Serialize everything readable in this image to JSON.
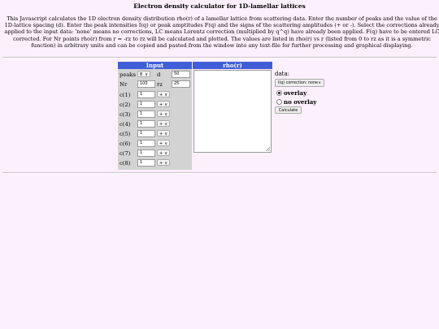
{
  "page": {
    "title": "Electron density calculator for 1D-lamellar lattices",
    "intro_lines": [
      "This Javascript calculates the 1D electron density distribution rho(r) of a lamellar lattice from scattering data. Enter the number of peaks and the value of the",
      "1D-lattice spacing (d). Enter the peak intensities I(q) or peak amptitudes F(q) and the signs of the scattering amplitudes (+ or -). Select the corrections already",
      "applied to the input data: 'none' means no corrections, LC means Lorentz correction (multiplied by q^q) have already been applied. F(q) have to be entered LC",
      "corrected. For Nr points rho(r) from r = -rz to rz will be calculated and plotted. The values are listed in rho(r) vs r (listed from 0 to rz as it is a symmetric",
      "function) in arbitrary units and can be copied and pasted from the window into any text-file for further processing and graphical displaying."
    ]
  },
  "input_panel": {
    "header": "Input",
    "peaks_label": "peaks",
    "peaks_value": "8",
    "d_label": "d",
    "d_value": "50",
    "nr_label": "Nr",
    "nr_value": "100",
    "rz_label": "rz",
    "rz_value": "25",
    "coefficients": [
      {
        "label": "c(1)",
        "value": "1",
        "sign": "+"
      },
      {
        "label": "c(2)",
        "value": "1",
        "sign": "+"
      },
      {
        "label": "c(3)",
        "value": "1",
        "sign": "+"
      },
      {
        "label": "c(4)",
        "value": "1",
        "sign": "+"
      },
      {
        "label": "c(5)",
        "value": "1",
        "sign": "+"
      },
      {
        "label": "c(6)",
        "value": "1",
        "sign": "+"
      },
      {
        "label": "c(7)",
        "value": "1",
        "sign": "+"
      },
      {
        "label": "c(8)",
        "value": "1",
        "sign": "+"
      }
    ]
  },
  "rho_panel": {
    "header": "rho(r)",
    "content": ""
  },
  "controls": {
    "data_label": "data:",
    "correction_select": "I(q) correction: none",
    "overlay_label": "overlay",
    "no_overlay_label": "no overlay",
    "calculate_label": "Calculate"
  }
}
